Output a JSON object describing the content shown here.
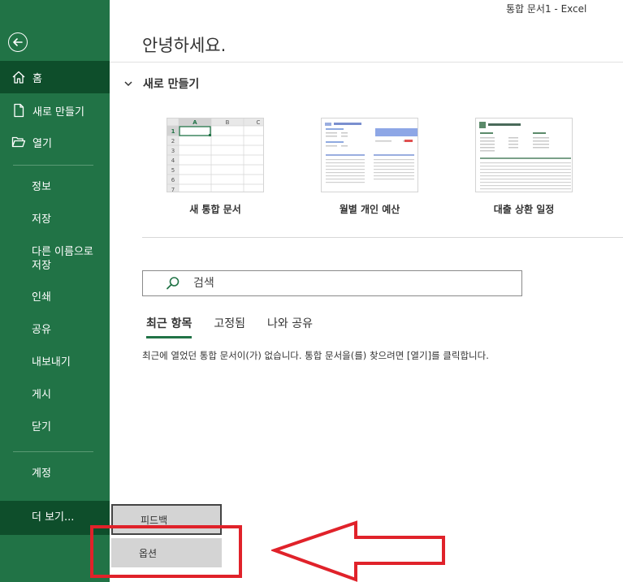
{
  "window": {
    "title": "통합 문서1  -  Excel"
  },
  "sidebar": {
    "home": "홈",
    "new": "새로 만들기",
    "open": "열기",
    "items": [
      "정보",
      "저장",
      "다른 이름으로 저장",
      "인쇄",
      "공유",
      "내보내기",
      "게시",
      "닫기"
    ],
    "account": "계정",
    "more": "더 보기..."
  },
  "main": {
    "greeting": "안녕하세요.",
    "new_section": "새로 만들기",
    "templates": [
      {
        "label": "새 통합 문서"
      },
      {
        "label": "월별 개인 예산"
      },
      {
        "label": "대출 상환 일정"
      }
    ],
    "blank_grid": {
      "columns": [
        "A",
        "B",
        "C"
      ],
      "rows": [
        "1",
        "2",
        "3",
        "4",
        "5",
        "6",
        "7"
      ]
    },
    "search_placeholder": "검색",
    "tabs": [
      "최근 항목",
      "고정됨",
      "나와 공유"
    ],
    "empty_message": "최근에 열었던 통합 문서이(가) 없습니다. 통합 문서을(를) 찾으려면 [열기]를 클릭합니다."
  },
  "popup": {
    "feedback": "피드백",
    "options": "옵션"
  },
  "colors": {
    "accent": "#217346",
    "sidebar_active": "#0e4e2b",
    "annotation": "#e0222a"
  }
}
